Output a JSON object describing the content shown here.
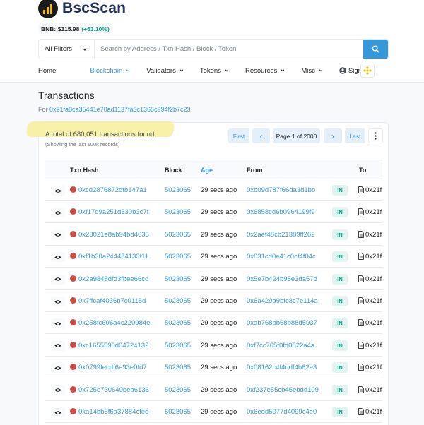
{
  "brand": {
    "name": "BscScan"
  },
  "price": {
    "label": "BNB: $315.98",
    "change": "(+63.10%)"
  },
  "search": {
    "filter_label": "All Filters",
    "placeholder": "Search by Address / Txn Hash / Block / Token"
  },
  "nav": {
    "home": "Home",
    "blockchain": "Blockchain",
    "validators": "Validators",
    "tokens": "Tokens",
    "resources": "Resources",
    "misc": "Misc",
    "signin": "Sign In"
  },
  "page": {
    "title": "Transactions",
    "for_prefix": "For",
    "address": "0x21fa8ca35441e70ad1137fa3c1365c994f2b7c23"
  },
  "summary": {
    "total": "A total of 680,051 transactions found",
    "note": "(Showing the last 100k records)"
  },
  "pagination": {
    "first": "First",
    "prev": "‹",
    "page_prefix": "Page",
    "current": "1",
    "of": "of",
    "total_pages": "2000",
    "next": "›",
    "last": "Last"
  },
  "table": {
    "headers": {
      "txn_hash": "Txn Hash",
      "block": "Block",
      "age": "Age",
      "from": "From",
      "to": "To"
    },
    "rows": [
      {
        "hash": "0xcd2876872dfb147a1",
        "block": "5023065",
        "age": "29 secs ago",
        "from": "0xb09d787f66da3d1bb",
        "dir": "IN",
        "to": "0x21f"
      },
      {
        "hash": "0xf17d9a251d330b3c7f",
        "block": "5023065",
        "age": "29 secs ago",
        "from": "0x6858cd6b0964199f9",
        "dir": "IN",
        "to": "0x21f"
      },
      {
        "hash": "0x23021e8ab94bd4635",
        "block": "5023065",
        "age": "29 secs ago",
        "from": "0x2aef48cb21389ff262",
        "dir": "IN",
        "to": "0x21f"
      },
      {
        "hash": "0xf1b30a244484133f11",
        "block": "5023065",
        "age": "29 secs ago",
        "from": "0x031cd0e41c0cf4f04c",
        "dir": "IN",
        "to": "0x21f"
      },
      {
        "hash": "0x2a9848dfd3fbee66cd",
        "block": "5023065",
        "age": "29 secs ago",
        "from": "0x5e7b424b95e3da57d",
        "dir": "IN",
        "to": "0x21f"
      },
      {
        "hash": "0x7ffcaf4036b7c0115d",
        "block": "5023065",
        "age": "29 secs ago",
        "from": "0x6a429a9bfc8c7e114a",
        "dir": "IN",
        "to": "0x21f"
      },
      {
        "hash": "0x258fc696a4c220984e",
        "block": "5023065",
        "age": "29 secs ago",
        "from": "0xab768bb68b88d5937",
        "dir": "IN",
        "to": "0x21f"
      },
      {
        "hash": "0xc1655590d04724132",
        "block": "5023065",
        "age": "29 secs ago",
        "from": "0xf7cc765f0fd0822a4a",
        "dir": "IN",
        "to": "0x21f"
      },
      {
        "hash": "0x0799fecdf6e93e0fd7",
        "block": "5023065",
        "age": "29 secs ago",
        "from": "0x08162c4f4ddf4b82e3",
        "dir": "IN",
        "to": "0x21f"
      },
      {
        "hash": "0x725e730640beb6136",
        "block": "5023065",
        "age": "29 secs ago",
        "from": "0xf237e55cb45ebdd109",
        "dir": "IN",
        "to": "0x21f"
      },
      {
        "hash": "0xa14bb5f6a37884cfee",
        "block": "5023065",
        "age": "29 secs ago",
        "from": "0x6edd5077d4099c4e0",
        "dir": "IN",
        "to": "0x21f"
      }
    ]
  },
  "colors": {
    "accent": "#3498db",
    "success": "#00a186",
    "error": "#de4437",
    "highlight": "#f7ee9b",
    "brand_dark": "#21325b"
  }
}
